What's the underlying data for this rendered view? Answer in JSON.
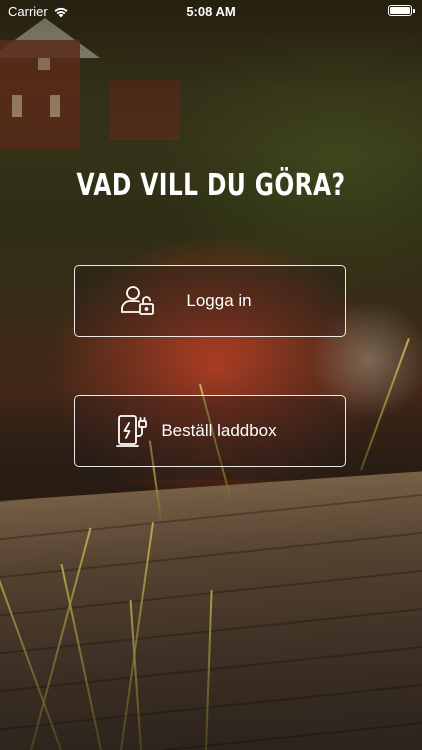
{
  "status_bar": {
    "carrier": "Carrier",
    "time": "5:08 AM",
    "battery_level": 1.0
  },
  "page": {
    "title": "VAD VILL DU GÖRA?"
  },
  "actions": {
    "login": {
      "label": "Logga in",
      "icon": "user-lock-icon"
    },
    "order": {
      "label": "Beställ laddbox",
      "icon": "ev-charger-icon"
    }
  },
  "colors": {
    "text": "#ffffff",
    "button_border": "#ffffff"
  }
}
